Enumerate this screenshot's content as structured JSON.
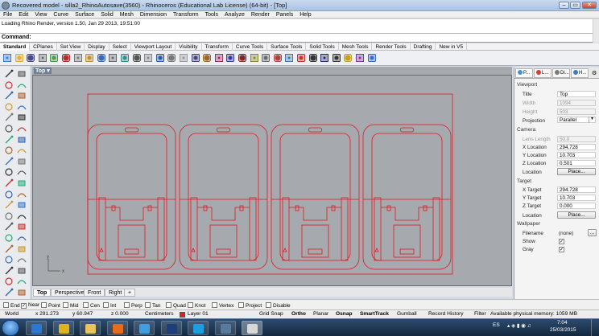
{
  "window": {
    "title": "Recovered model - silla2_RhinoAutosave(3560) - Rhinoceros (Educational Lab License) (64-bit) - [Top]",
    "controls": [
      "–",
      "▭",
      "✕"
    ]
  },
  "menu": [
    "File",
    "Edit",
    "View",
    "Curve",
    "Surface",
    "Solid",
    "Mesh",
    "Dimension",
    "Transform",
    "Tools",
    "Analyze",
    "Render",
    "Panels",
    "Help"
  ],
  "command": {
    "history": [
      "Loading Rhino Render, version 1.50, Jan 29 2013, 19:51:00",
      ""
    ],
    "prompt": "Command:"
  },
  "toolbar_tabs": [
    "Standard",
    "CPlanes",
    "Set View",
    "Display",
    "Select",
    "Viewport Layout",
    "Visibility",
    "Transform",
    "Curve Tools",
    "Surface Tools",
    "Solid Tools",
    "Mesh Tools",
    "Render Tools",
    "Drafting",
    "New in V5"
  ],
  "toolbar_icons": [
    "new-icon",
    "open-icon",
    "save-icon",
    "print-icon",
    "import-icon",
    "cut-icon",
    "copy-icon",
    "paste-icon",
    "undo-icon",
    "pan-icon",
    "rotate-view-icon",
    "zoom-icon",
    "zoom-window-icon",
    "zoom-extents-icon",
    "zoom-selected-icon",
    "zoom-all-icon",
    "four-view-icon",
    "options-icon",
    "select-points-icon",
    "points-on-icon",
    "grip-icon",
    "lock-icon",
    "hide-icon",
    "properties-icon",
    "layer-icon",
    "color-icon",
    "sphere-render-icon",
    "material-icon",
    "render-icon",
    "light-icon",
    "lens-icon",
    "help-icon"
  ],
  "viewport": {
    "title": "Top",
    "dropdown": "▾",
    "axis_x": "x",
    "axis_y": "y",
    "tabs": [
      "Top",
      "Perspective",
      "Front",
      "Right",
      "+"
    ],
    "active_tab": "Top"
  },
  "panel": {
    "tabs": [
      "P...",
      "L...",
      "Di...",
      "H..."
    ],
    "viewport_section": "Viewport",
    "fields": [
      {
        "label": "Title",
        "value": "Top",
        "disabled": false
      },
      {
        "label": "Width",
        "value": "1094",
        "disabled": true
      },
      {
        "label": "Height",
        "value": "503",
        "disabled": true
      },
      {
        "label": "Projection",
        "value": "Parallel",
        "disabled": false
      }
    ],
    "camera_section": "Camera",
    "camera": [
      {
        "label": "Lens Length",
        "value": "50.0",
        "disabled": true
      },
      {
        "label": "X Location",
        "value": "294.728",
        "disabled": false
      },
      {
        "label": "Y Location",
        "value": "10.703",
        "disabled": false
      },
      {
        "label": "Z Location",
        "value": "0.501",
        "disabled": false
      }
    ],
    "location_label": "Location",
    "place_button": "Place...",
    "target_section": "Target",
    "target": [
      {
        "label": "X Target",
        "value": "294.728"
      },
      {
        "label": "Y Target",
        "value": "10.703"
      },
      {
        "label": "Z Target",
        "value": "0.000"
      }
    ],
    "wallpaper_section": "Wallpaper",
    "wallpaper": {
      "filename_label": "Filename",
      "filename_value": "(none)",
      "browse": "...",
      "show_label": "Show",
      "show_checked": true,
      "gray_label": "Gray",
      "gray_checked": true
    }
  },
  "osnap": [
    {
      "label": "End",
      "checked": false
    },
    {
      "label": "Near",
      "checked": true
    },
    {
      "label": "Point",
      "checked": false
    },
    {
      "label": "Mid",
      "checked": false
    },
    {
      "label": "Cen",
      "checked": false
    },
    {
      "label": "Int",
      "checked": false
    },
    {
      "label": "Perp",
      "checked": false
    },
    {
      "label": "Tan",
      "checked": false
    },
    {
      "label": "Quad",
      "checked": false
    },
    {
      "label": "Knot",
      "checked": false
    },
    {
      "label": "Vertex",
      "checked": false
    },
    {
      "label": "Project",
      "checked": false
    },
    {
      "label": "Disable",
      "checked": false
    }
  ],
  "status": {
    "cplane": "World",
    "x": "x 291.273",
    "y": "y 60.947",
    "z": "z 0.000",
    "units": "Centimeters",
    "layer": "Layer 01",
    "layer_color": "#e02020",
    "grid_snap": "Grid Snap",
    "ortho": "Ortho",
    "planar": "Planar",
    "osnap": "Osnap",
    "smarttrack": "SmartTrack",
    "gumball": "Gumball",
    "record_history": "Record History",
    "filter": "Filter",
    "memory": "Available physical memory: 1059 MB"
  },
  "taskbar": {
    "lang": "ES",
    "time": "7:04",
    "date": "25/03/2015",
    "apps": [
      "ie-icon",
      "chrome-icon",
      "explorer-icon",
      "media-player-icon",
      "app-icon",
      "photoshop-icon",
      "skype-icon",
      "image-viewer-icon",
      "rhino-icon"
    ]
  },
  "colors": {
    "curve": "#e8141e",
    "viewport_bg": "#a6a9ad"
  }
}
